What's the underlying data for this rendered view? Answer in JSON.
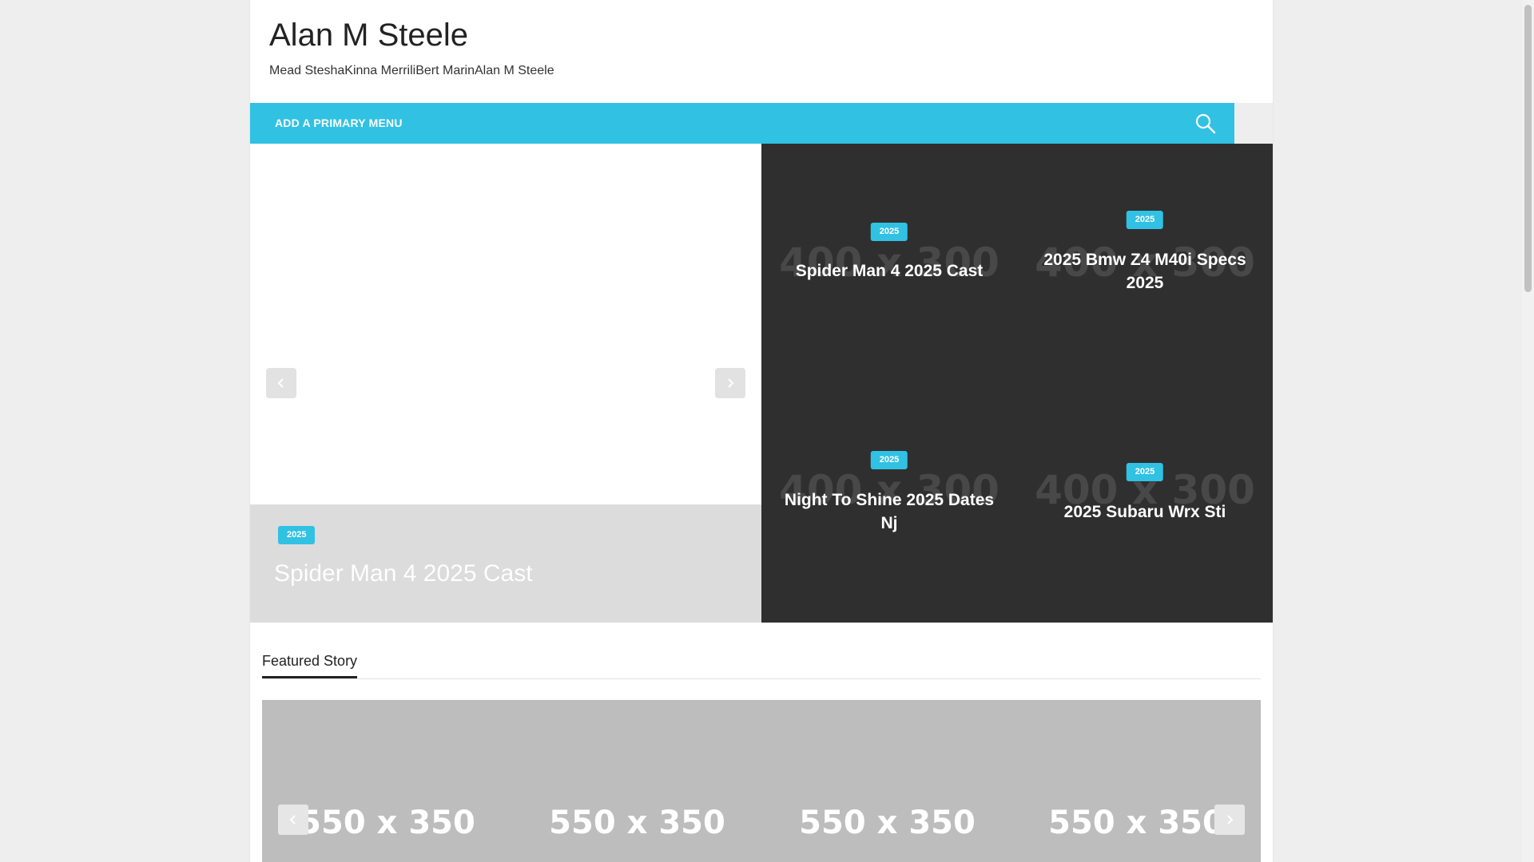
{
  "site": {
    "title": "Alan M Steele",
    "description": "Mead SteshaKinna MerriliBert MarinAlan M Steele"
  },
  "nav": {
    "primary_menu_label": "ADD A PRIMARY MENU",
    "search_icon": "search-icon"
  },
  "hero": {
    "badge": "2025",
    "title": "Spider Man 4 2025 Cast",
    "prev_icon": "chevron-left-icon",
    "next_icon": "chevron-right-icon"
  },
  "grid": {
    "placeholder": "400 x 300",
    "items": [
      {
        "badge": "2025",
        "title": "Spider Man 4 2025 Cast"
      },
      {
        "badge": "2025",
        "title": "2025 Bmw Z4 M40i Specs 2025"
      },
      {
        "badge": "2025",
        "title": "Night To Shine 2025 Dates Nj"
      },
      {
        "badge": "2025",
        "title": "2025 Subaru Wrx Sti"
      }
    ]
  },
  "featured": {
    "heading": "Featured Story",
    "placeholders": [
      "550 x 350",
      "550 x 350",
      "550 x 350",
      "550 x 350"
    ],
    "prev_icon": "chevron-left-icon",
    "next_icon": "chevron-right-icon"
  },
  "colors": {
    "accent": "#31c1e3",
    "grid_bg": "#2f2f2f",
    "hero_caption_bg": "#dcdcdc",
    "featured_bg": "#bdbdbd"
  }
}
